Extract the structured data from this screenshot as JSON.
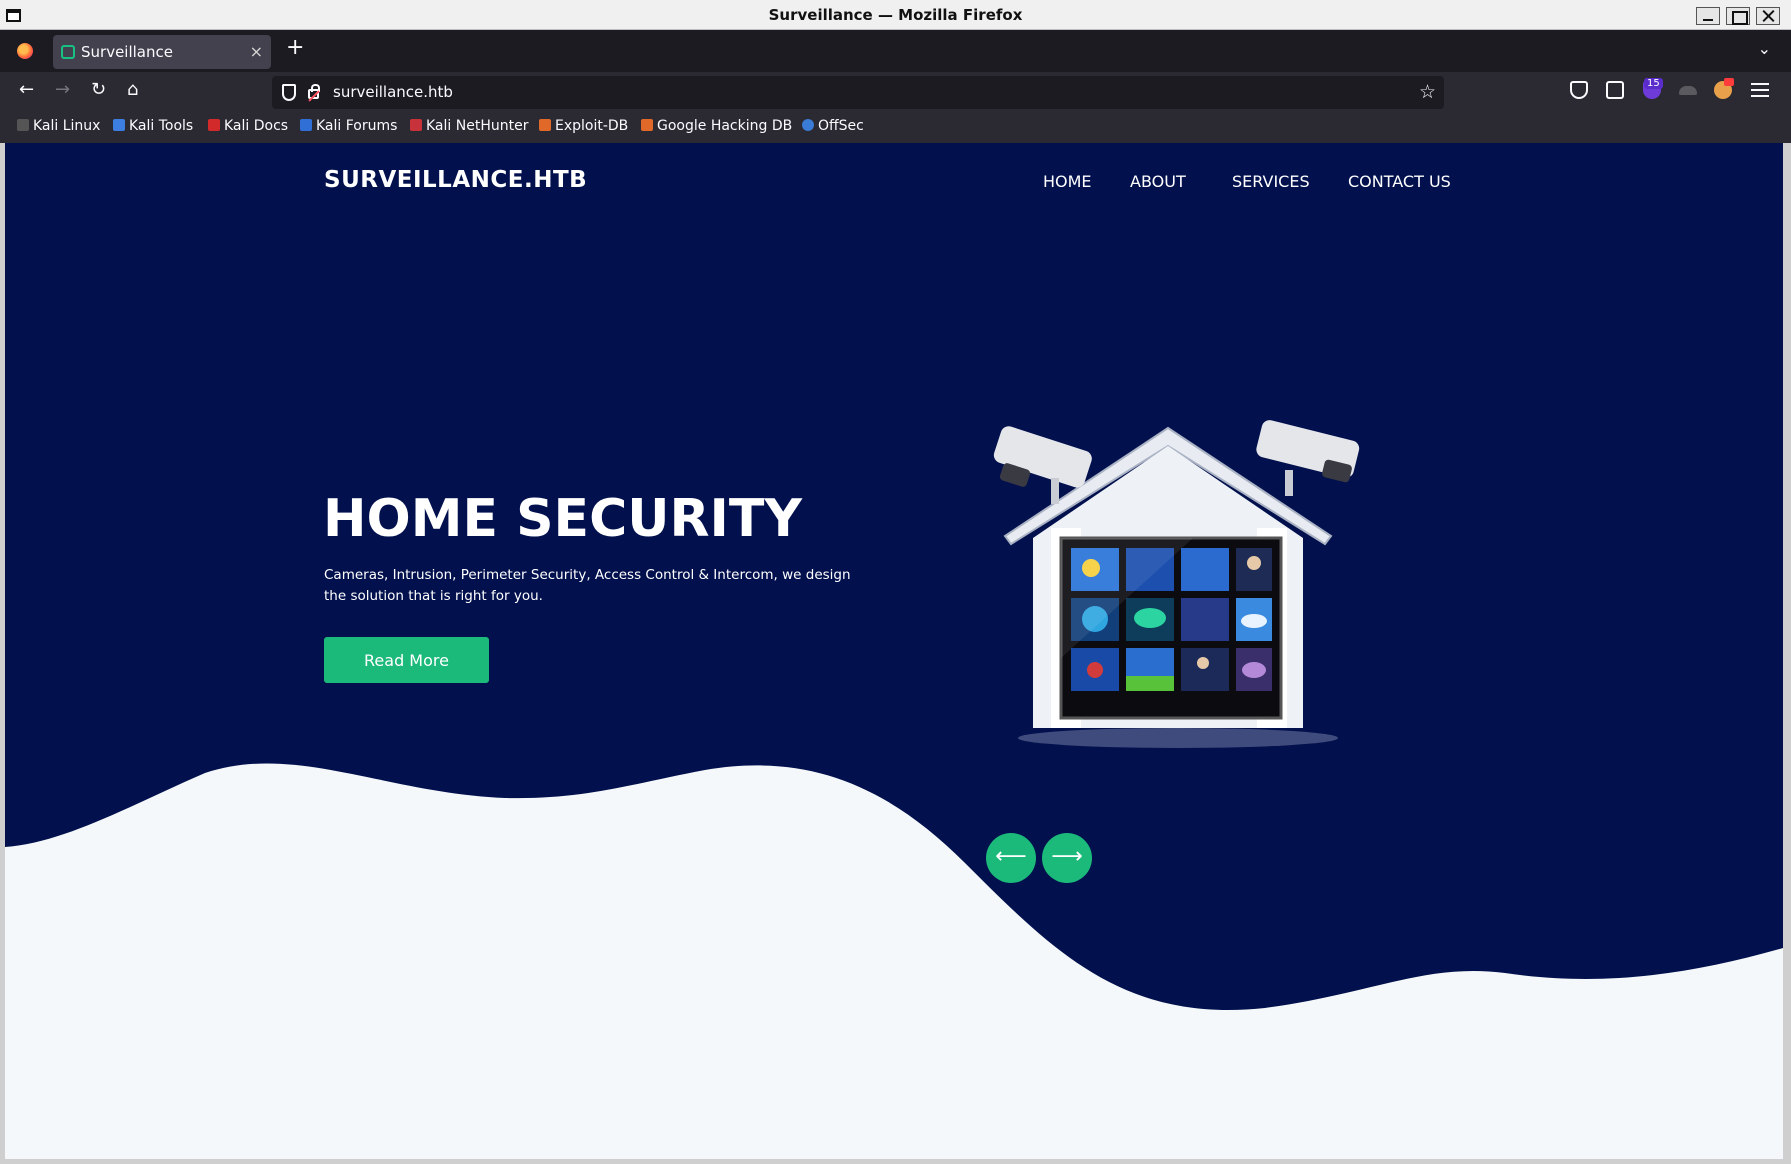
{
  "window": {
    "title": "Surveillance — Mozilla Firefox"
  },
  "tab": {
    "title": "Surveillance",
    "close": "×"
  },
  "toolbar": {
    "url": "surveillance.htb",
    "ublock_count": "15"
  },
  "bookmarks": [
    "Kali Linux",
    "Kali Tools",
    "Kali Docs",
    "Kali Forums",
    "Kali NetHunter",
    "Exploit-DB",
    "Google Hacking DB",
    "OffSec"
  ],
  "site": {
    "brand": "SURVEILLANCE.HTB",
    "nav": [
      "HOME",
      "ABOUT",
      "SERVICES",
      "CONTACT US"
    ],
    "hero": {
      "title": "HOME SECURITY",
      "text": "Cameras, Intrusion, Perimeter Security, Access Control & Intercom, we design the solution that is right for you.",
      "button": "Read More"
    },
    "slider": {
      "prev": "⟵",
      "next": "⟶"
    }
  },
  "colors": {
    "hero_bg": "#02114d",
    "accent": "#1bb97a",
    "wave": "#f4f8fa"
  }
}
